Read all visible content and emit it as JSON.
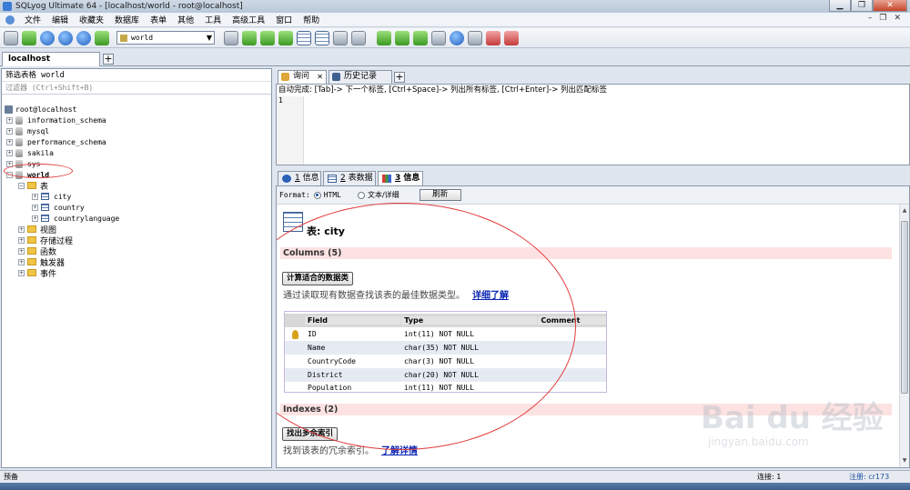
{
  "window": {
    "title": "SQLyog Ultimate 64 - [localhost/world - root@localhost]"
  },
  "menubar": {
    "items": [
      "文件",
      "编辑",
      "收藏夹",
      "数据库",
      "表单",
      "其他",
      "工具",
      "高级工具",
      "窗口",
      "帮助"
    ]
  },
  "toolbar": {
    "db_select": "world"
  },
  "connection_tabs": {
    "active": "localhost"
  },
  "left_panel": {
    "filter_label": "筛选表格 world",
    "filter_placeholder": "过滤器 (Ctrl+Shift+B)",
    "root": "root@localhost",
    "databases": [
      "information_schema",
      "mysql",
      "performance_schema",
      "sakila",
      "sys",
      "world"
    ],
    "world_children": {
      "tables_folder": "表",
      "tables": [
        "city",
        "country",
        "countrylanguage"
      ],
      "folders": [
        "视图",
        "存储过程",
        "函数",
        "触发器",
        "事件"
      ]
    }
  },
  "query": {
    "tabs": [
      "询问",
      "历史记录"
    ],
    "hint": "自动完成: [Tab]-> 下一个标签, [Ctrl+Space]-> 列出所有标签, [Ctrl+Enter]-> 列出匹配标签",
    "line_number": "1"
  },
  "result_tabs": {
    "tab1_num": "1",
    "tab1_label": "信息",
    "tab2_num": "2",
    "tab2_label": "表数据",
    "tab3_num": "3",
    "tab3_label": "信息"
  },
  "info": {
    "format_label": "Format:",
    "format_html": "HTML",
    "format_text": "文本/详细",
    "refresh": "刷新",
    "table_title": "表: city",
    "columns_header": "Columns (5)",
    "calc_button": "计算适合的数据类",
    "calc_desc": "通过读取现有数据查找该表的最佳数据类型。",
    "calc_link": "详细了解",
    "col_headers": [
      "Field",
      "Type",
      "Comment"
    ],
    "columns": [
      {
        "field": "ID",
        "type": "int(11) NOT NULL",
        "comment": "",
        "key": true
      },
      {
        "field": "Name",
        "type": "char(35) NOT NULL",
        "comment": "",
        "key": false
      },
      {
        "field": "CountryCode",
        "type": "char(3) NOT NULL",
        "comment": "",
        "key": false
      },
      {
        "field": "District",
        "type": "char(20) NOT NULL",
        "comment": "",
        "key": false
      },
      {
        "field": "Population",
        "type": "int(11) NOT NULL",
        "comment": "",
        "key": false
      }
    ],
    "indexes_header": "Indexes (2)",
    "redundant_button": "找出多余索引",
    "redundant_desc": "找到该表的冗余索引。",
    "redundant_link": "了解详情"
  },
  "statusbar": {
    "left": "预备",
    "connection": "连接: 1",
    "registration": "注册: cr173"
  },
  "watermark": {
    "text": "Bai du 经验",
    "url": "jingyan.baidu.com"
  },
  "colors": {
    "section_bar": "#fde2e2",
    "link": "#0a26b3",
    "annotation_circle": "#e23a3a"
  }
}
